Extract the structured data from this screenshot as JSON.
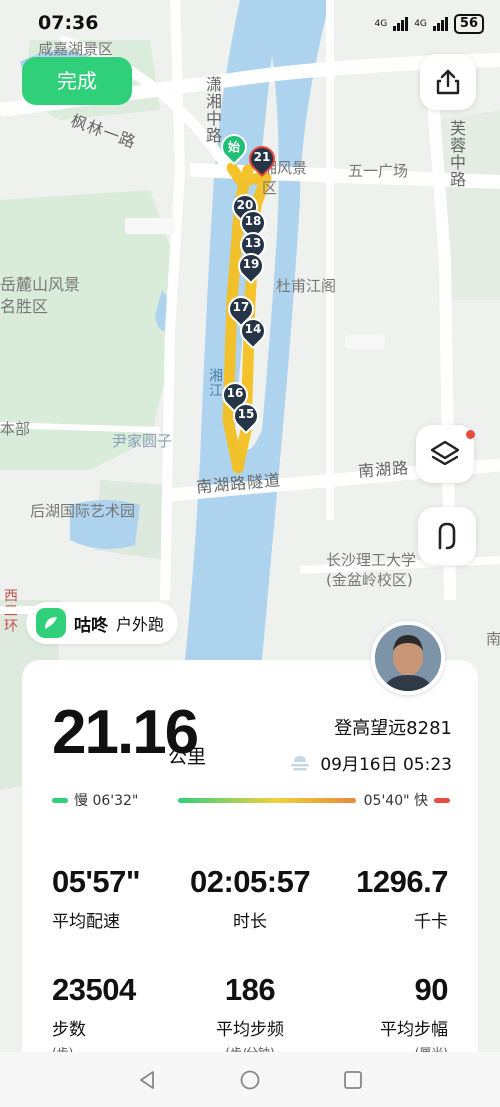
{
  "status_bar": {
    "time": "07:36",
    "network1": "4G",
    "network2": "4G",
    "battery": "56"
  },
  "top": {
    "done_label": "完成"
  },
  "map": {
    "labels": {
      "xianjia": "咸嘉湖景区",
      "fenglin": "枫林一路",
      "xiaoxiang": "潇湘中路",
      "scenic": "湘风景区",
      "wuyi": "五一广场",
      "furong": "芙蓉中路",
      "yuelu": "岳麓山风景名胜区",
      "dunan": "杜甫江阁",
      "xiang": "湘江",
      "yinjia": "尹家圆子",
      "nanhu_tunnel": "南湖路隧道",
      "nanhu": "南湖路",
      "houhu": "后湖国际艺术园",
      "csut": "长沙理工大学(金盆岭校区)",
      "benbu": "本部",
      "nan_partial": "南",
      "west_partial": "西二环"
    },
    "route_color": "#f3c020",
    "water_color": "#aed3ef",
    "markers": [
      {
        "label": "始",
        "kind": "start"
      },
      {
        "label": "21",
        "kind": "end"
      },
      {
        "label": "20",
        "kind": "km"
      },
      {
        "label": "18",
        "kind": "km"
      },
      {
        "label": "13",
        "kind": "km"
      },
      {
        "label": "19",
        "kind": "km"
      },
      {
        "label": "17",
        "kind": "km"
      },
      {
        "label": "14",
        "kind": "km"
      },
      {
        "label": "16",
        "kind": "km"
      },
      {
        "label": "15",
        "kind": "km"
      }
    ]
  },
  "brand": {
    "name": "咕咚",
    "activity": "户外跑"
  },
  "summary": {
    "distance": "21.16",
    "unit": "公里",
    "user": "登高望远8281",
    "date": "09月16日 05:23",
    "pace_slow_label": "慢 06'32\"",
    "pace_fast_label": "05'40\" 快",
    "pace_colors": {
      "slow": "#30cf7e",
      "fast": "#e74c3c"
    }
  },
  "stats": [
    {
      "value": "05'57\"",
      "label": "平均配速",
      "sub": ""
    },
    {
      "value": "02:05:57",
      "label": "时长",
      "sub": ""
    },
    {
      "value": "1296.7",
      "label": "千卡",
      "sub": ""
    },
    {
      "value": "23504",
      "label": "步数",
      "sub": "(步)"
    },
    {
      "value": "186",
      "label": "平均步频",
      "sub": "(步/分钟)"
    },
    {
      "value": "90",
      "label": "平均步幅",
      "sub": "(厘米)"
    }
  ],
  "icons": [
    "share-icon",
    "layers-icon",
    "route-icon",
    "weather-icon",
    "back-icon",
    "home-icon",
    "recent-icon"
  ]
}
